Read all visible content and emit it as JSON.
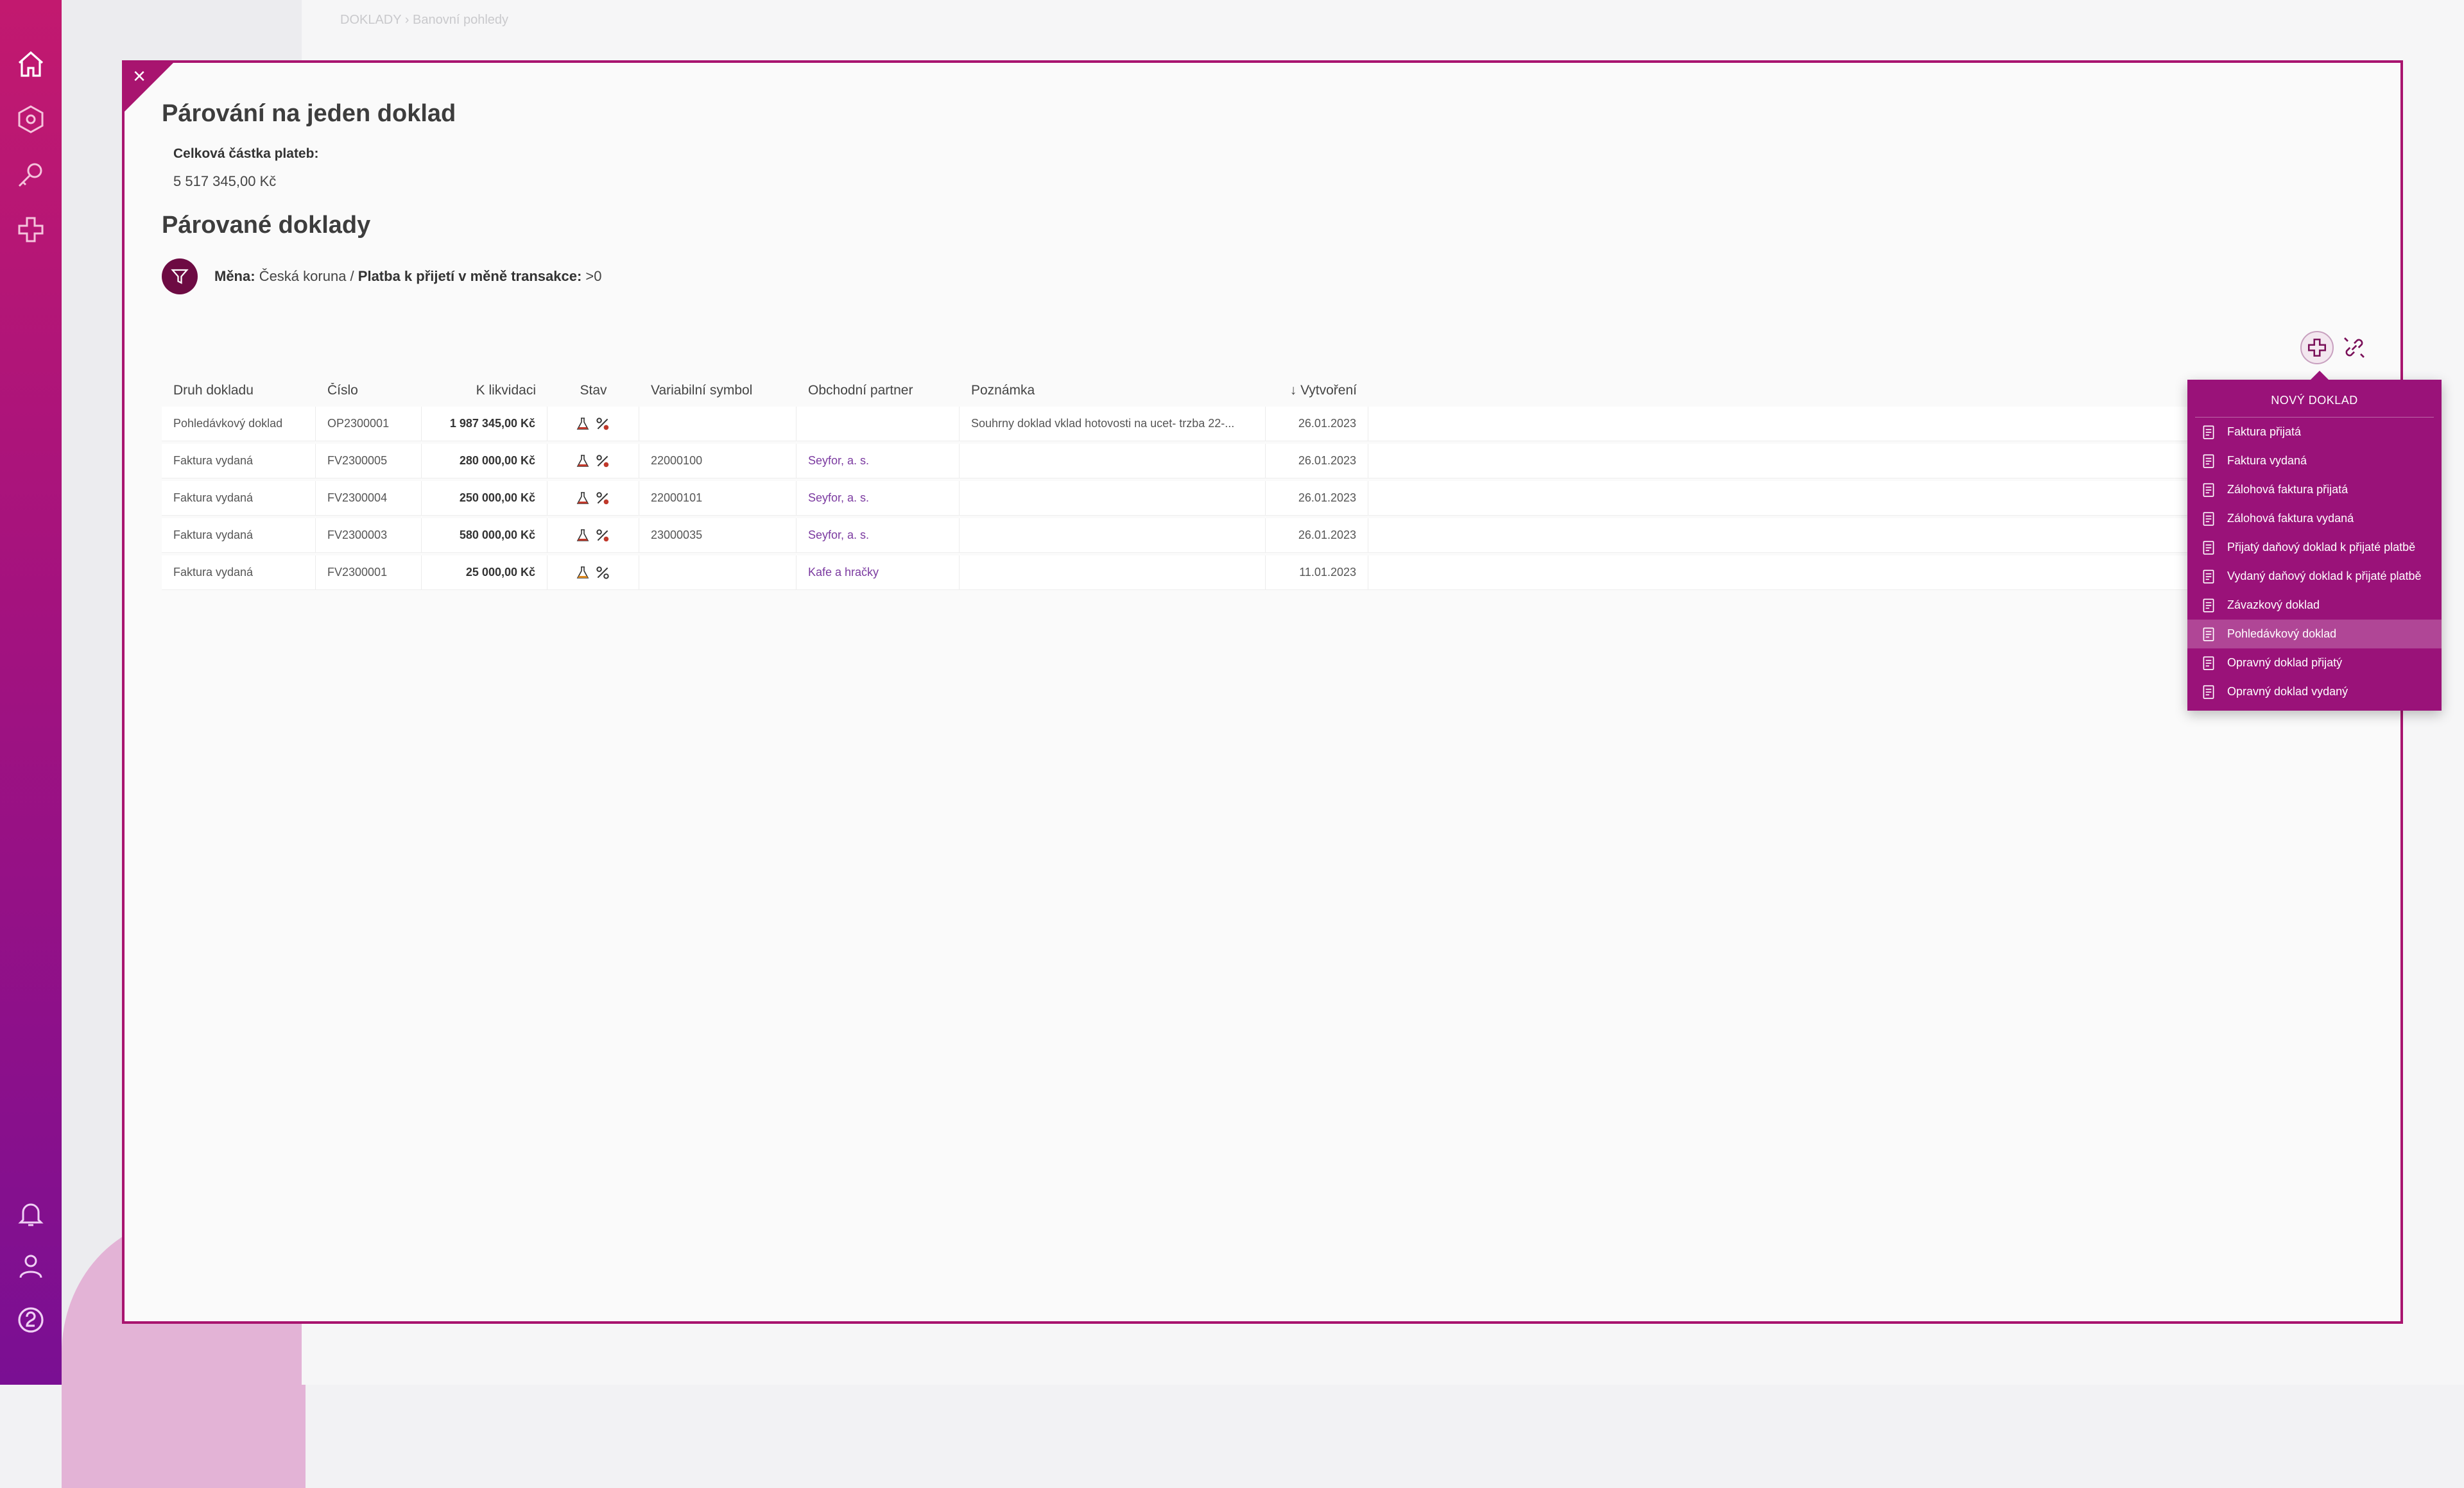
{
  "background": {
    "breadcrumb": "DOKLADY  ›  Banovní pohledy"
  },
  "modal": {
    "close_label": "×",
    "title": "Párování na jeden doklad",
    "total_label": "Celková částka plateb:",
    "total_value": "5 517 345,00 Kč",
    "section_title": "Párované doklady",
    "filter": {
      "mena_label": "Měna:",
      "mena_value": "Česká koruna",
      "separator": " / ",
      "platba_label": "Platba k přijetí v měně transakce:",
      "platba_value": ">0"
    }
  },
  "table": {
    "headers": {
      "druh": "Druh dokladu",
      "cislo": "Číslo",
      "likvidaci": "K likvidaci",
      "stav": "Stav",
      "vs": "Variabilní symbol",
      "partner": "Obchodní partner",
      "poznamka": "Poznámka",
      "vytvoreni": "↓ Vytvoření"
    },
    "rows": [
      {
        "druh": "Pohledávkový doklad",
        "cislo": "OP2300001",
        "likvidaci": "1 987 345,00 Kč",
        "vs": "",
        "partner": "",
        "poznamka": "Souhrny doklad vklad hotovosti na ucet- trzba 22-...",
        "vytvoreni": "26.01.2023",
        "flask_color": "#c0392b"
      },
      {
        "druh": "Faktura vydaná",
        "cislo": "FV2300005",
        "likvidaci": "280 000,00 Kč",
        "vs": "22000100",
        "partner": "Seyfor, a. s.",
        "poznamka": "",
        "vytvoreni": "26.01.2023",
        "flask_color": "#c0392b"
      },
      {
        "druh": "Faktura vydaná",
        "cislo": "FV2300004",
        "likvidaci": "250 000,00 Kč",
        "vs": "22000101",
        "partner": "Seyfor, a. s.",
        "poznamka": "",
        "vytvoreni": "26.01.2023",
        "flask_color": "#c0392b"
      },
      {
        "druh": "Faktura vydaná",
        "cislo": "FV2300003",
        "likvidaci": "580 000,00 Kč",
        "vs": "23000035",
        "partner": "Seyfor, a. s.",
        "poznamka": "",
        "vytvoreni": "26.01.2023",
        "flask_color": "#c0392b"
      },
      {
        "druh": "Faktura vydaná",
        "cislo": "FV2300001",
        "likvidaci": "25 000,00 Kč",
        "vs": "",
        "partner": "Kafe a hračky",
        "poznamka": "",
        "vytvoreni": "11.01.2023",
        "flask_color": "#e08a1e"
      }
    ]
  },
  "dropdown": {
    "header": "NOVÝ DOKLAD",
    "items": [
      "Faktura přijatá",
      "Faktura vydaná",
      "Zálohová faktura přijatá",
      "Zálohová faktura vydaná",
      "Přijatý daňový doklad k přijaté platbě",
      "Vydaný daňový doklad k přijaté platbě",
      "Závazkový doklad",
      "Pohledávkový doklad",
      "Opravný doklad přijatý",
      "Opravný doklad vydaný"
    ],
    "highlighted_index": 7
  },
  "colors": {
    "accent": "#a8146f",
    "dropdown_bg": "#9a1279",
    "filter_button": "#6d0b43",
    "link": "#7b3aa0"
  },
  "icons": {
    "rail": [
      "home-icon",
      "hexagon-icon",
      "search-key-icon",
      "plus-icon",
      "bell-icon",
      "user-icon",
      "help-icon"
    ],
    "actions": [
      "add-icon",
      "unlink-icon"
    ]
  }
}
